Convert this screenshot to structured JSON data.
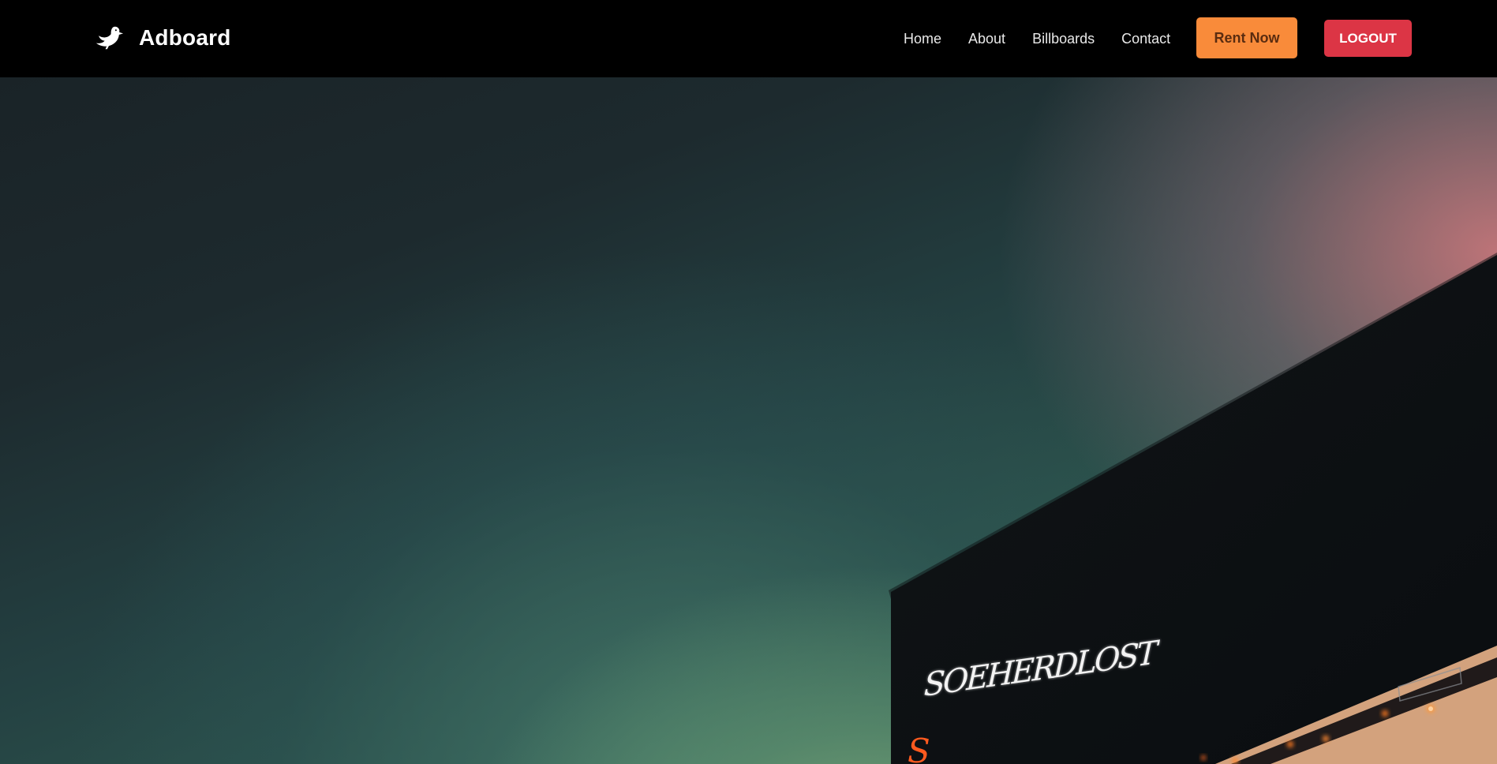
{
  "brand": {
    "name": "Adboard",
    "icon": "bird-icon"
  },
  "nav": {
    "items": [
      {
        "label": "Home"
      },
      {
        "label": "About"
      },
      {
        "label": "Billboards"
      },
      {
        "label": "Contact"
      }
    ],
    "rent_label": "Rent Now",
    "logout_label": "LOGOUT"
  },
  "hero": {
    "billboard_text": "SOEHERDLOST"
  },
  "colors": {
    "navbar_bg": "#000000",
    "rent_button": "#f98b3a",
    "logout_button": "#dc3545"
  }
}
